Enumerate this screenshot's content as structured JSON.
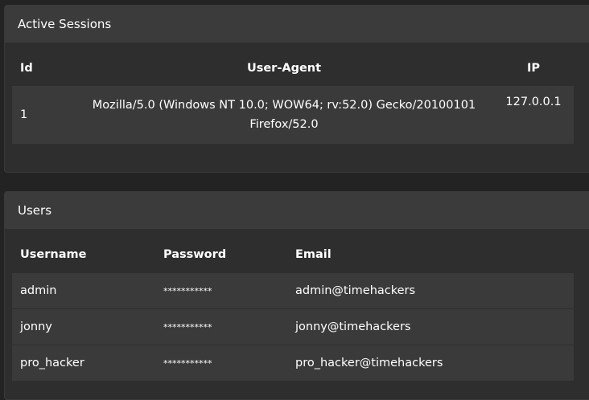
{
  "sessions": {
    "title": "Active Sessions",
    "columns": {
      "id": "Id",
      "user_agent": "User-Agent",
      "ip": "IP"
    },
    "rows": [
      {
        "id": "1",
        "user_agent_line1": "Mozilla/5.0 (Windows NT 10.0; WOW64; rv:52.0) Gecko/20100101",
        "user_agent_line2": "Firefox/52.0",
        "ip": "127.0.0.1"
      }
    ]
  },
  "users": {
    "title": "Users",
    "columns": {
      "username": "Username",
      "password": "Password",
      "email": "Email"
    },
    "rows": [
      {
        "username": "admin",
        "password": "***********",
        "email": "admin@timehackers"
      },
      {
        "username": "jonny",
        "password": "***********",
        "email": "jonny@timehackers"
      },
      {
        "username": "pro_hacker",
        "password": "***********",
        "email": "pro_hacker@timehackers"
      }
    ]
  }
}
